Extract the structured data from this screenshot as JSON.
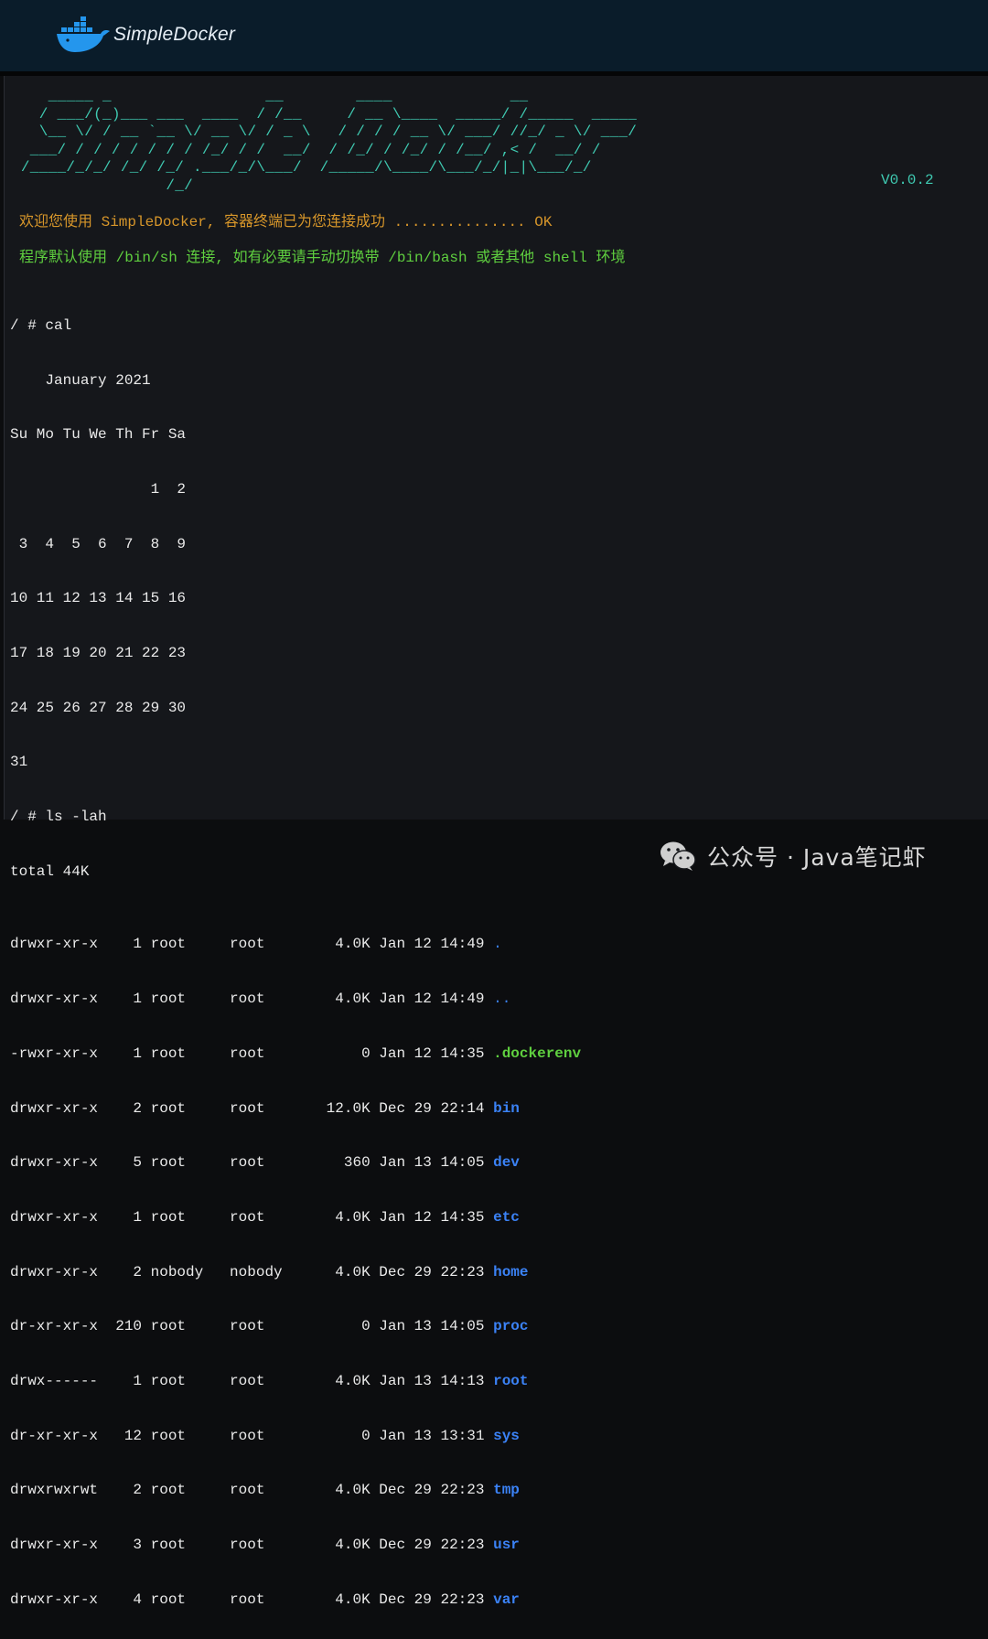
{
  "header": {
    "brand": "SimpleDocker",
    "logo_icon": "docker-whale-icon"
  },
  "terminal": {
    "ascii_banner": "    _____ _                 __        ____             __\n   / ___/(_)___ ___  ____  / /__     / __ \\____  _____/ /_____  _____\n   \\__ \\/ / __ `__ \\/ __ \\/ / _ \\   / / / / __ \\/ ___/ //_/ _ \\/ ___/\n  ___/ / / / / / / / /_/ / /  __/  / /_/ / /_/ / /__/ ,< /  __/ /\n /____/_/_/ /_/ /_/ .___/_/\\___/  /_____/\\____/\\___/_/|_|\\___/_/\n                 /_/",
    "version": "V0.0.2",
    "welcome": "欢迎您使用 SimpleDocker, 容器终端已为您连接成功 ............... OK",
    "info": "程序默认使用 /bin/sh 连接, 如有必要请手动切换带 /bin/bash 或者其他 shell 环境",
    "cal_prompt": "/ # cal",
    "cal_lines": [
      "    January 2021",
      "Su Mo Tu We Th Fr Sa",
      "                1  2",
      " 3  4  5  6  7  8  9",
      "10 11 12 13 14 15 16",
      "17 18 19 20 21 22 23",
      "24 25 26 27 28 29 30",
      "31"
    ],
    "ls_prompt": "/ # ls -lah",
    "ls_total": "total 44K",
    "ls_rows": [
      {
        "meta": "drwxr-xr-x    1 root     root        4.0K Jan 12 14:49 ",
        "name": ".",
        "kind": "dot"
      },
      {
        "meta": "drwxr-xr-x    1 root     root        4.0K Jan 12 14:49 ",
        "name": "..",
        "kind": "dot"
      },
      {
        "meta": "-rwxr-xr-x    1 root     root           0 Jan 12 14:35 ",
        "name": ".dockerenv",
        "kind": "exec"
      },
      {
        "meta": "drwxr-xr-x    2 root     root       12.0K Dec 29 22:14 ",
        "name": "bin",
        "kind": "dir"
      },
      {
        "meta": "drwxr-xr-x    5 root     root         360 Jan 13 14:05 ",
        "name": "dev",
        "kind": "dir"
      },
      {
        "meta": "drwxr-xr-x    1 root     root        4.0K Jan 12 14:35 ",
        "name": "etc",
        "kind": "dir"
      },
      {
        "meta": "drwxr-xr-x    2 nobody   nobody      4.0K Dec 29 22:23 ",
        "name": "home",
        "kind": "dir"
      },
      {
        "meta": "dr-xr-xr-x  210 root     root           0 Jan 13 14:05 ",
        "name": "proc",
        "kind": "dir"
      },
      {
        "meta": "drwx------    1 root     root        4.0K Jan 13 14:13 ",
        "name": "root",
        "kind": "dir"
      },
      {
        "meta": "dr-xr-xr-x   12 root     root           0 Jan 13 13:31 ",
        "name": "sys",
        "kind": "dir"
      },
      {
        "meta": "drwxrwxrwt    2 root     root        4.0K Dec 29 22:23 ",
        "name": "tmp",
        "kind": "dir"
      },
      {
        "meta": "drwxr-xr-x    3 root     root        4.0K Dec 29 22:23 ",
        "name": "usr",
        "kind": "dir"
      },
      {
        "meta": "drwxr-xr-x    4 root     root        4.0K Dec 29 22:23 ",
        "name": "var",
        "kind": "dir"
      }
    ],
    "final_prompt": "/ # "
  },
  "watermark": {
    "text": "公众号 · Java笔记虾",
    "icon": "wechat-icon"
  },
  "colors": {
    "ascii": "#3fc9b1",
    "welcome": "#d7962a",
    "info": "#5fcf3f",
    "directory": "#3b82f6",
    "cursor": "#f0a020"
  }
}
